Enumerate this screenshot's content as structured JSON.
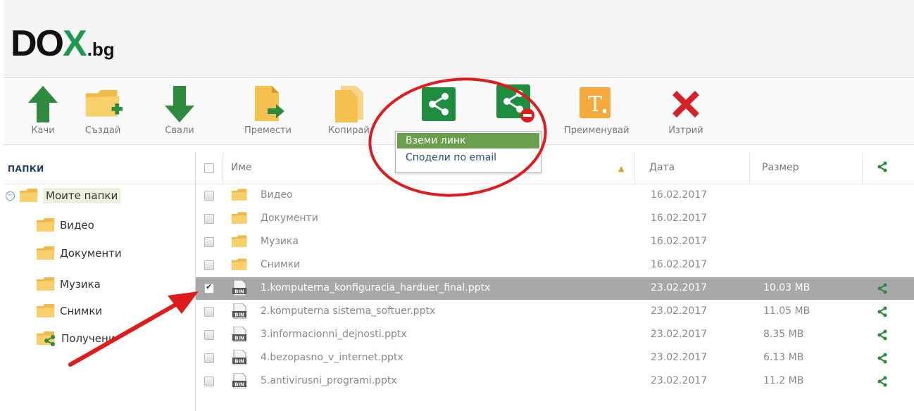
{
  "logo": {
    "brand_main_1": "DO",
    "brand_main_2": "X",
    "brand_tld": ".bg"
  },
  "toolbar": {
    "upload": "Качи",
    "create": "Създай",
    "download": "Свали",
    "move": "Премести",
    "copy": "Копирай",
    "rename": "Преименувай",
    "delete": "Изтрий"
  },
  "share_menu": {
    "get_link": "Вземи линк",
    "share_email": "Сподели по email"
  },
  "sidebar": {
    "title": "ПАПКИ",
    "root": "Моите папки",
    "items": [
      "Видео",
      "Документи",
      "Музика",
      "Снимки",
      "Получени"
    ]
  },
  "table": {
    "headers": {
      "name": "Име",
      "date": "Дата",
      "size": "Размер"
    },
    "rows": [
      {
        "name": "Видео",
        "type": "folder",
        "date": "16.02.2017",
        "size": ""
      },
      {
        "name": "Документи",
        "type": "folder",
        "date": "16.02.2017",
        "size": ""
      },
      {
        "name": "Музика",
        "type": "folder",
        "date": "16.02.2017",
        "size": ""
      },
      {
        "name": "Снимки",
        "type": "folder",
        "date": "16.02.2017",
        "size": ""
      },
      {
        "name": "1.komputerna_konfiguracia_harduer_final.pptx",
        "type": "file",
        "date": "23.02.2017",
        "size": "10.03 MB",
        "selected": true
      },
      {
        "name": "2.komputerna sistema_softuer.pptx",
        "type": "file",
        "date": "23.02.2017",
        "size": "11.05 MB"
      },
      {
        "name": "3.informacionni_dejnosti.pptx",
        "type": "file",
        "date": "23.02.2017",
        "size": "8.35 MB"
      },
      {
        "name": "4.bezopasno_v_internet.pptx",
        "type": "file",
        "date": "23.02.2017",
        "size": "6.13 MB"
      },
      {
        "name": "5.antivirusni_programi.pptx",
        "type": "file",
        "date": "23.02.2017",
        "size": "11.2 MB"
      }
    ]
  },
  "file_icon_text": "BIN",
  "colors": {
    "accent_green": "#1d9a4e",
    "selected_row": "#a8a8a8",
    "annotation_red": "#e01b1b",
    "menu_active": "#6a9f4d"
  }
}
